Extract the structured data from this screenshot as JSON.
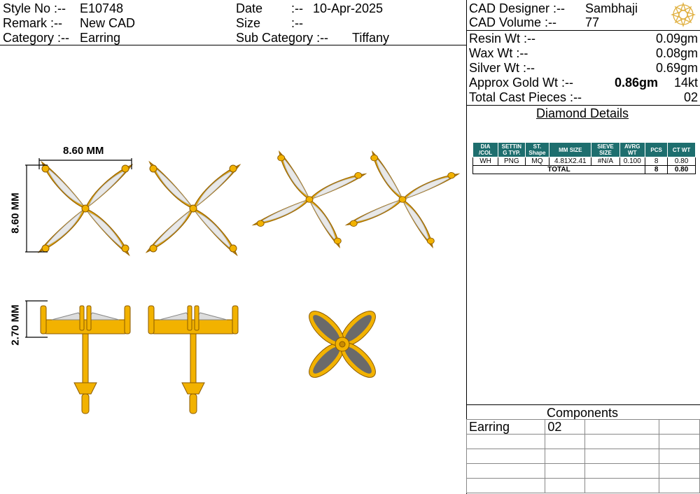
{
  "header": {
    "style_no_label": "Style No :--",
    "style_no": "E10748",
    "remark_label": "Remark :--",
    "remark": "New CAD",
    "category_label": "Category :--",
    "category": "Earring",
    "date_label": "Date",
    "date_sep": ":--",
    "date": "10-Apr-2025",
    "size_label": "Size",
    "size_sep": ":--",
    "subcategory_label": "Sub Category :--",
    "subcategory": "Tiffany"
  },
  "cad": {
    "designer_label": "CAD   Designer :--",
    "designer": "Sambhaji",
    "volume_label": "CAD   Volume  :--",
    "volume": "77"
  },
  "weights": {
    "resin_label": "Resin Wt :--",
    "resin": "0.09gm",
    "wax_label": "Wax   Wt :--",
    "wax": "0.08gm",
    "silver_label": "Silver Wt :--",
    "silver": "0.69gm",
    "gold_label": "Approx Gold Wt :--",
    "gold": "0.86gm",
    "gold_kt": "14kt",
    "cast_label": "Total Cast Pieces :--",
    "cast": "02"
  },
  "diamond": {
    "title": "Diamond Details",
    "headers": [
      "DIA /COL",
      "SETTIN G TYP.",
      "ST. Shape",
      "MM SIZE",
      "SIEVE SIZE",
      "AVRG WT",
      "PCS",
      "CT WT"
    ],
    "row": [
      "WH",
      "PNG",
      "MQ",
      "4.81X2.41",
      "#N/A",
      "0.100",
      "8",
      "0.80"
    ],
    "total_label": "TOTAL",
    "total_pcs": "8",
    "total_ct": "0.80"
  },
  "dimensions": {
    "width": "8.60 MM",
    "height": "8.60 MM",
    "depth": "2.70 MM"
  },
  "components": {
    "title": "Components",
    "rows": [
      [
        "Earring",
        "02"
      ],
      [
        "",
        ""
      ],
      [
        "",
        ""
      ],
      [
        "",
        ""
      ],
      [
        "",
        ""
      ]
    ]
  },
  "colors": {
    "gold": "#f2b200",
    "gold_dark": "#b07800",
    "stone": "#e6e6e6",
    "teal": "#1e6e6e"
  }
}
